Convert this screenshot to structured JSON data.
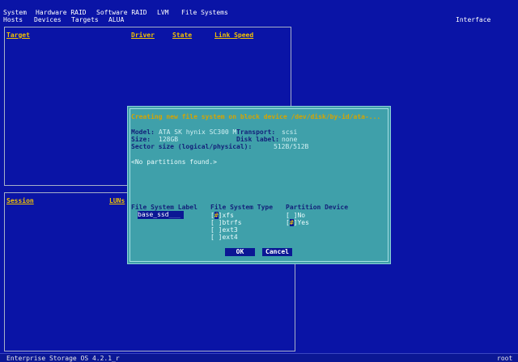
{
  "menu": {
    "row1": [
      "System",
      "Hardware RAID",
      "Software RAID",
      "LVM",
      "File Systems"
    ],
    "row2": [
      "Hosts",
      "Devices",
      "Targets",
      "ALUA"
    ],
    "right": "Interface"
  },
  "targets_panel": {
    "headers": [
      "Target",
      "Driver",
      "State",
      "Link Speed"
    ]
  },
  "session_panel": {
    "headers": [
      "Session",
      "LUNs"
    ]
  },
  "dialog": {
    "title": "Creating new file system on block device /dev/disk/by-id/ata-...",
    "model_label": "Model:",
    "model_value": "ATA SK hynix SC300 M",
    "transport_label": "Transport:",
    "transport_value": "scsi",
    "size_label": "Size:",
    "size_value": "128GB",
    "disk_label_label": "Disk label:",
    "disk_label_value": "none",
    "sector_label": "Sector size (logical/physical):",
    "sector_value": "512B/512B",
    "partitions_note": "<No partitions found.>",
    "fs_label_header": "File System Label",
    "fs_label_value": "base_ssd",
    "fs_label_fill": "___",
    "fs_type_header": "File System Type",
    "fs_types": [
      {
        "label": "xfs",
        "selected": true
      },
      {
        "label": "btrfs",
        "selected": false
      },
      {
        "label": "ext3",
        "selected": false
      },
      {
        "label": "ext4",
        "selected": false
      }
    ],
    "partition_header": "Partition Device",
    "partition_options": [
      {
        "label": "No",
        "selected": false
      },
      {
        "label": "Yes",
        "selected": true
      }
    ],
    "ok_label": "OK",
    "cancel_label": "Cancel"
  },
  "status_bar": {
    "left": "Enterprise Storage OS 4.2.1_r",
    "right": "root"
  }
}
